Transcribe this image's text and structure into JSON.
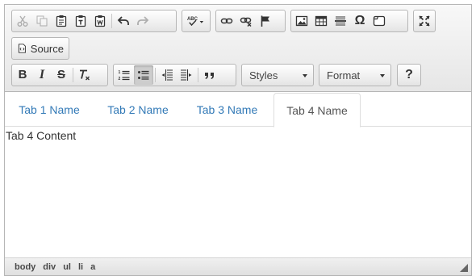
{
  "toolbar": {
    "clipboard": [
      "cut",
      "copy",
      "paste",
      "paste-text",
      "paste-from-word"
    ],
    "history": [
      "undo",
      "redo"
    ],
    "spellcheck": "spell-check",
    "links": [
      "link",
      "unlink",
      "anchor"
    ],
    "insert": [
      "image",
      "table",
      "horizontal-line",
      "special-character",
      "iframe"
    ],
    "tools": [
      "maximize"
    ],
    "source_label": "Source",
    "basicstyles": [
      "bold",
      "italic",
      "strikethrough",
      "remove-format"
    ],
    "lists": [
      "numbered-list",
      "bulleted-list"
    ],
    "indent": [
      "decrease-indent",
      "increase-indent",
      "blockquote"
    ],
    "styles_label": "Styles",
    "format_label": "Format",
    "help_label": "?"
  },
  "tabs": [
    {
      "label": "Tab 1 Name",
      "active": false
    },
    {
      "label": "Tab 2 Name",
      "active": false
    },
    {
      "label": "Tab 3 Name",
      "active": false
    },
    {
      "label": "Tab 4 Name",
      "active": true
    }
  ],
  "tab_content": "Tab 4 Content",
  "statusbar": {
    "path": [
      "body",
      "div",
      "ul",
      "li",
      "a"
    ]
  },
  "colors": {
    "tab_link": "#337ab7",
    "tab_active": "#555555",
    "toolbar_bg": "#e6e6e6"
  }
}
